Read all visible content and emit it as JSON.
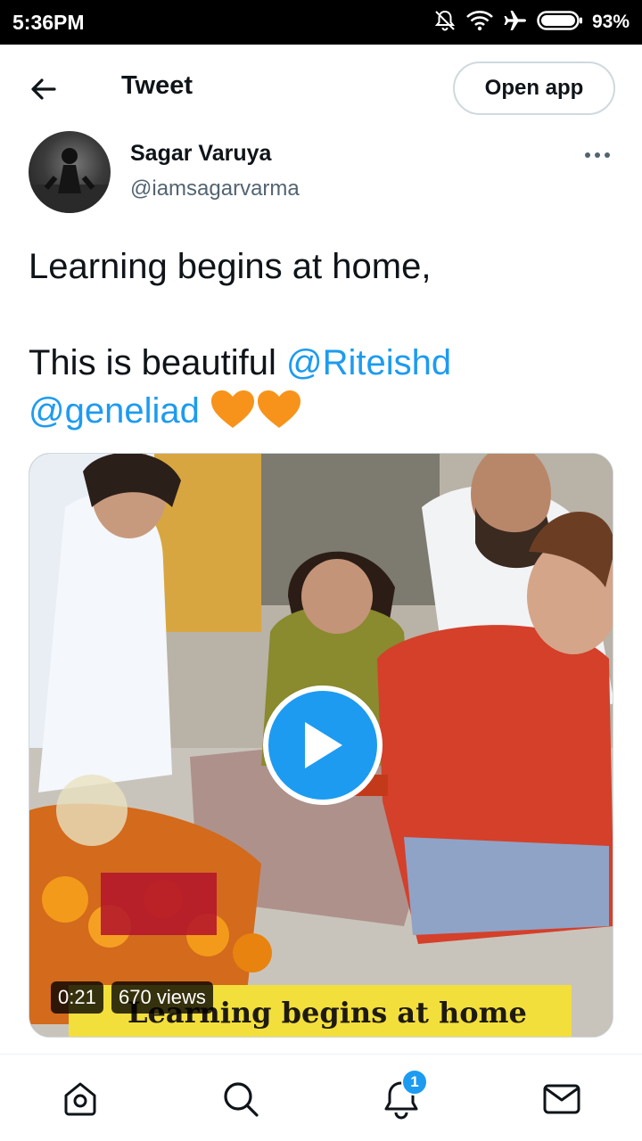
{
  "status_bar": {
    "time": "5:36PM",
    "battery": "93%"
  },
  "header": {
    "title": "Tweet",
    "open_app_label": "Open app"
  },
  "tweet": {
    "author_name": "Sagar Varuya",
    "author_handle": "@iamsagarvarma",
    "text_line1": "Learning begins at home,",
    "text_line2_prefix": "This is beautiful ",
    "mention1": "@Riteishd",
    "mention2": "@geneliad",
    "heart_color": "#f7931a"
  },
  "media": {
    "duration": "0:21",
    "views": "670 views",
    "caption": "Learning begins at home",
    "play_color": "#1d9bf0"
  },
  "bottom_nav": {
    "items": [
      "home-icon",
      "search-icon",
      "notifications-icon",
      "messages-icon"
    ],
    "notification_count": "1"
  }
}
